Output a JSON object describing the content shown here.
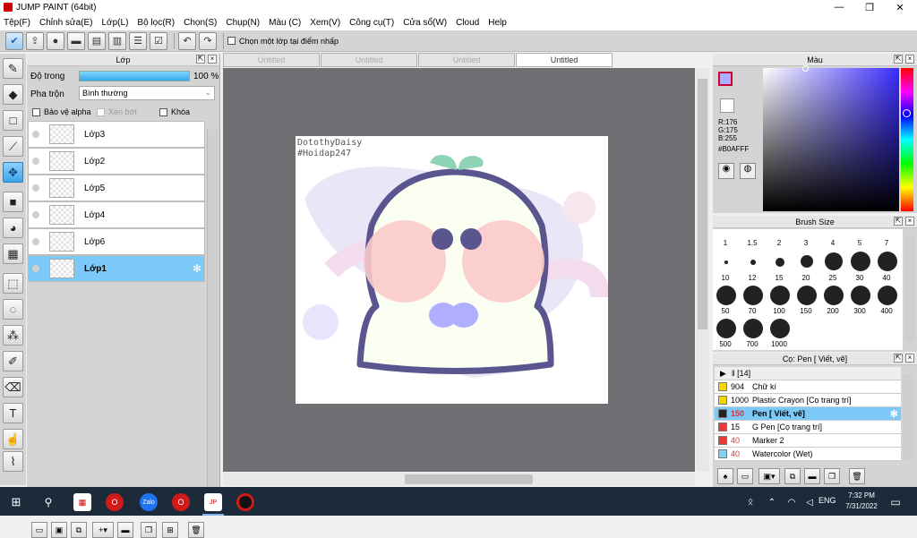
{
  "window": {
    "title": "JUMP PAINT (64bit)"
  },
  "menu": [
    "Tệp(F)",
    "Chỉnh sửa(E)",
    "Lớp(L)",
    "Bộ lọc(R)",
    "Chọn(S)",
    "Chụp(N)",
    "Màu (C)",
    "Xem(V)",
    "Công cụ(T)",
    "Cửa sổ(W)",
    "Cloud",
    "Help"
  ],
  "toolbar": {
    "select_layer_label": "Chọn một lớp tại điểm nhấp"
  },
  "layer_panel": {
    "title": "Lớp",
    "opacity_label": "Độ trong",
    "opacity_value": "100 %",
    "opacity": 1.0,
    "blend_label": "Pha trộn",
    "blend_value": "Bình thường",
    "protect_alpha": "Bảo vệ alpha",
    "clip": "Xén bớt",
    "lock": "Khóa",
    "layers": [
      {
        "name": "Lớp3",
        "selected": false
      },
      {
        "name": "Lớp2",
        "selected": false
      },
      {
        "name": "Lớp5",
        "selected": false
      },
      {
        "name": "Lớp4",
        "selected": false
      },
      {
        "name": "Lớp6",
        "selected": false
      },
      {
        "name": "Lớp1",
        "selected": true
      }
    ]
  },
  "tabs": [
    "Untitled",
    "Untitled",
    "Untitled",
    "Untitled"
  ],
  "canvas": {
    "watermark_line1": "DotothyDaisy",
    "watermark_line2": "#Hoidap247"
  },
  "color_panel": {
    "title": "Màu",
    "r": "R:176",
    "g": "G:175",
    "b": "B:255",
    "hex": "#B0AFFF",
    "current_color": "#B0AFFF"
  },
  "brush_size": {
    "title": "Brush Size",
    "sizes": [
      "1",
      "1.5",
      "2",
      "3",
      "4",
      "5",
      "7",
      "10",
      "12",
      "15",
      "20",
      "25",
      "30",
      "40",
      "50",
      "70",
      "100",
      "150",
      "200",
      "300",
      "400",
      "500",
      "700",
      "1000"
    ]
  },
  "brush_panel": {
    "title": "Cọ: Pen [ Viết, vẽ]",
    "group": "ǁ [14]",
    "brushes": [
      {
        "size": "904",
        "name": "Chữ kí",
        "color": "#f2d800",
        "selected": false
      },
      {
        "size": "1000",
        "name": "Plastic Crayon [Cọ trang trí]",
        "color": "#f2d800",
        "selected": false
      },
      {
        "size": "150",
        "name": "Pen [ Viết, vẽ]",
        "color": "#222222",
        "selected": true
      },
      {
        "size": "15",
        "name": "G Pen [Cọ trang trí]",
        "color": "#e83a3a",
        "selected": false
      },
      {
        "size": "40",
        "name": "Marker 2",
        "color": "#e83a3a",
        "selected": false
      },
      {
        "size": "40",
        "name": "Watercolor (Wet)",
        "color": "#7fd3f0",
        "selected": false
      }
    ]
  },
  "taskbar": {
    "lang": "ENG",
    "time": "7:32 PM",
    "date": "7/31/2022"
  }
}
